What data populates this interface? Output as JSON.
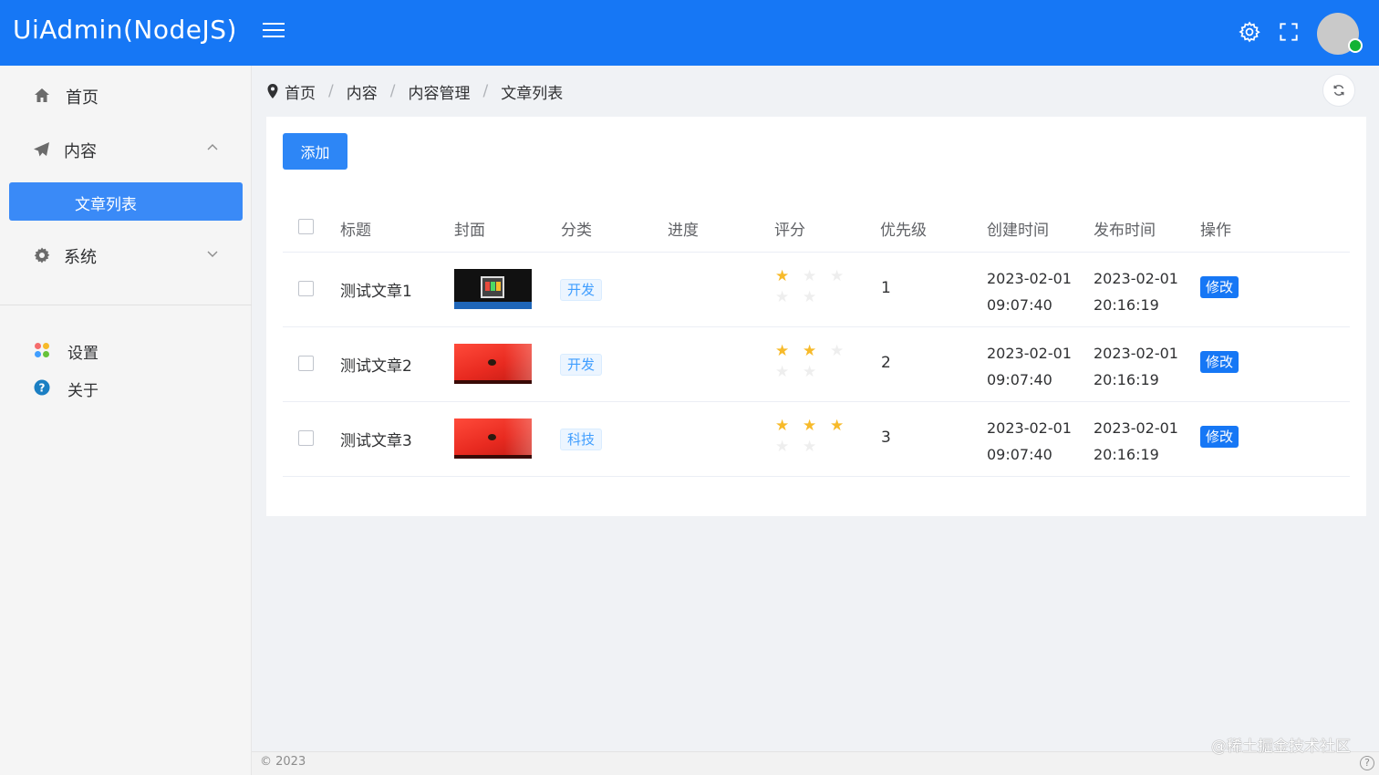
{
  "app": {
    "title": "UiAdmin(NodeJS)"
  },
  "colors": {
    "primary": "#1677f5",
    "star_on": "#f7ba2a",
    "online": "#12b334"
  },
  "header": {
    "icons": [
      "menu-icon",
      "gear-icon",
      "fullscreen-icon",
      "avatar"
    ]
  },
  "sidebar": {
    "items": [
      {
        "label": "首页",
        "icon": "home-icon"
      },
      {
        "label": "内容",
        "icon": "paper-plane-icon",
        "expanded": true
      },
      {
        "label": "文章列表",
        "active": true
      },
      {
        "label": "系统",
        "icon": "gear-icon",
        "expanded": false
      }
    ],
    "links": [
      {
        "label": "设置",
        "icon": "apps-icon"
      },
      {
        "label": "关于",
        "icon": "help-circle-icon"
      }
    ]
  },
  "breadcrumb": [
    "首页",
    "内容",
    "内容管理",
    "文章列表"
  ],
  "breadcrumb_sep": "/",
  "toolbar": {
    "add_label": "添加"
  },
  "table": {
    "headers": [
      "标题",
      "封面",
      "分类",
      "进度",
      "评分",
      "优先级",
      "创建时间",
      "发布时间",
      "操作"
    ],
    "rows": [
      {
        "title": "测试文章1",
        "cover": "tv-screen-image",
        "category": "开发",
        "rating": 1,
        "rating_max": 3,
        "priority": "1",
        "created_date": "2023-02-01",
        "created_time": "09:07:40",
        "published_date": "2023-02-01",
        "published_time": "20:16:19",
        "action": "修改"
      },
      {
        "title": "测试文章2",
        "cover": "red-car-image",
        "category": "开发",
        "rating": 2,
        "rating_max": 3,
        "priority": "2",
        "created_date": "2023-02-01",
        "created_time": "09:07:40",
        "published_date": "2023-02-01",
        "published_time": "20:16:19",
        "action": "修改"
      },
      {
        "title": "测试文章3",
        "cover": "red-car-image",
        "category": "科技",
        "rating": 3,
        "rating_max": 3,
        "priority": "3",
        "created_date": "2023-02-01",
        "created_time": "09:07:40",
        "published_date": "2023-02-01",
        "published_time": "20:16:19",
        "action": "修改"
      }
    ]
  },
  "footer": {
    "copyright": "© 2023",
    "watermark": "@稀土掘金技术社区"
  }
}
